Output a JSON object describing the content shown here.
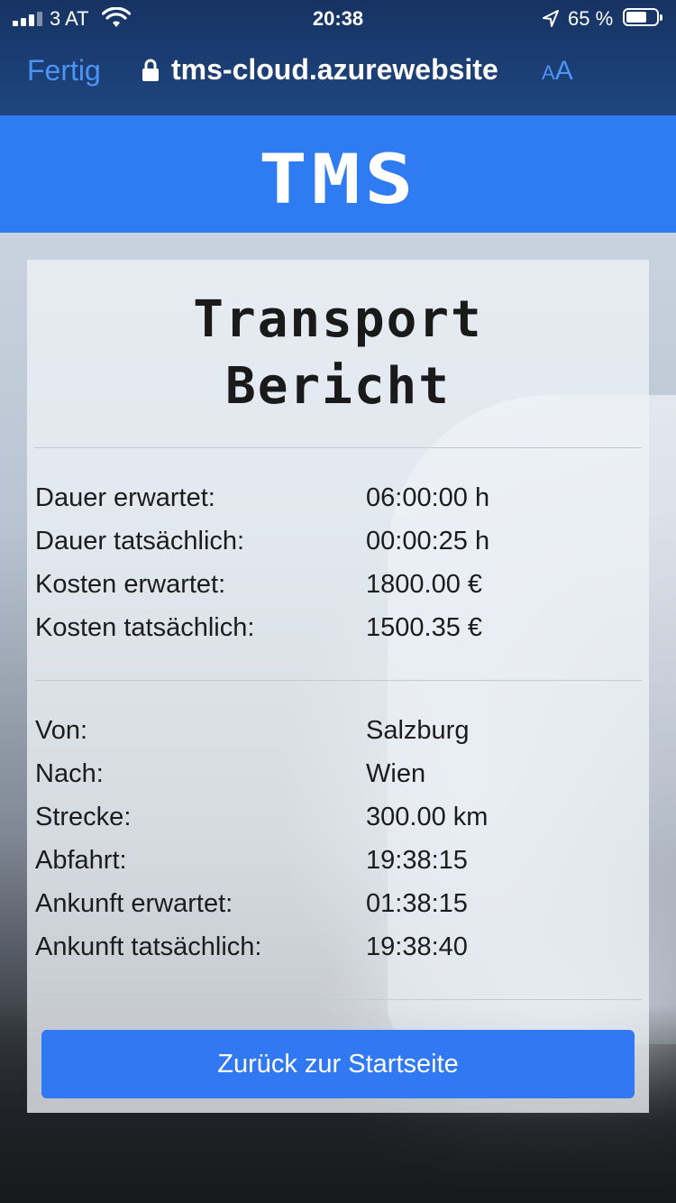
{
  "status_bar": {
    "carrier": "3 AT",
    "time": "20:38",
    "battery_percent": "65 %"
  },
  "browser": {
    "done_label": "Fertig",
    "url": "tms-cloud.azurewebsite",
    "text_size_label_small": "A",
    "text_size_label_large": "A"
  },
  "header": {
    "logo": "TMS"
  },
  "report": {
    "title_line1": "Transport",
    "title_line2": "Bericht",
    "costs": [
      {
        "label": "Dauer erwartet:",
        "value": "06:00:00 h"
      },
      {
        "label": "Dauer tatsächlich:",
        "value": "00:00:25 h"
      },
      {
        "label": "Kosten erwartet:",
        "value": "1800.00 €"
      },
      {
        "label": "Kosten tatsächlich:",
        "value": "1500.35 €"
      }
    ],
    "route": [
      {
        "label": "Von:",
        "value": "Salzburg"
      },
      {
        "label": "Nach:",
        "value": "Wien"
      },
      {
        "label": "Strecke:",
        "value": "300.00 km"
      },
      {
        "label": "Abfahrt:",
        "value": "19:38:15"
      },
      {
        "label": "Ankunft erwartet:",
        "value": "01:38:15"
      },
      {
        "label": "Ankunft tatsächlich:",
        "value": "19:38:40"
      }
    ],
    "back_button": "Zurück zur Startseite"
  }
}
